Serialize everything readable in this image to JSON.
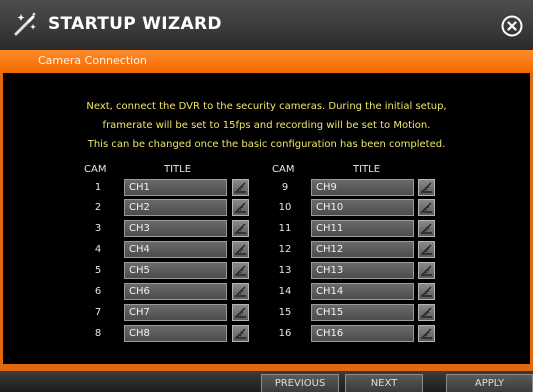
{
  "window": {
    "title": "STARTUP WIZARD",
    "section": "Camera Connection"
  },
  "info": {
    "lines": [
      "Next, connect the DVR to the security cameras. During the initial setup,",
      "framerate will be set to 15fps and recording will be set to Motion.",
      "This can be changed once the basic configuration has been completed."
    ]
  },
  "table": {
    "headers": {
      "cam": "CAM",
      "title": "TITLE"
    },
    "left": [
      {
        "cam": "1",
        "title": "CH1"
      },
      {
        "cam": "2",
        "title": "CH2"
      },
      {
        "cam": "3",
        "title": "CH3"
      },
      {
        "cam": "4",
        "title": "CH4"
      },
      {
        "cam": "5",
        "title": "CH5"
      },
      {
        "cam": "6",
        "title": "CH6"
      },
      {
        "cam": "7",
        "title": "CH7"
      },
      {
        "cam": "8",
        "title": "CH8"
      }
    ],
    "right": [
      {
        "cam": "9",
        "title": "CH9"
      },
      {
        "cam": "10",
        "title": "CH10"
      },
      {
        "cam": "11",
        "title": "CH11"
      },
      {
        "cam": "12",
        "title": "CH12"
      },
      {
        "cam": "13",
        "title": "CH13"
      },
      {
        "cam": "14",
        "title": "CH14"
      },
      {
        "cam": "15",
        "title": "CH15"
      },
      {
        "cam": "16",
        "title": "CH16"
      }
    ]
  },
  "buttons": {
    "previous": "PREVIOUS",
    "next": "NEXT",
    "apply": "APPLY"
  },
  "icons": {
    "wizard": "magic-wand-icon",
    "close": "close-circle-icon",
    "keyboard": "edit-keyboard-icon"
  },
  "colors": {
    "accent": "#f07a10",
    "info_text": "#f0e668",
    "background": "#000000"
  }
}
